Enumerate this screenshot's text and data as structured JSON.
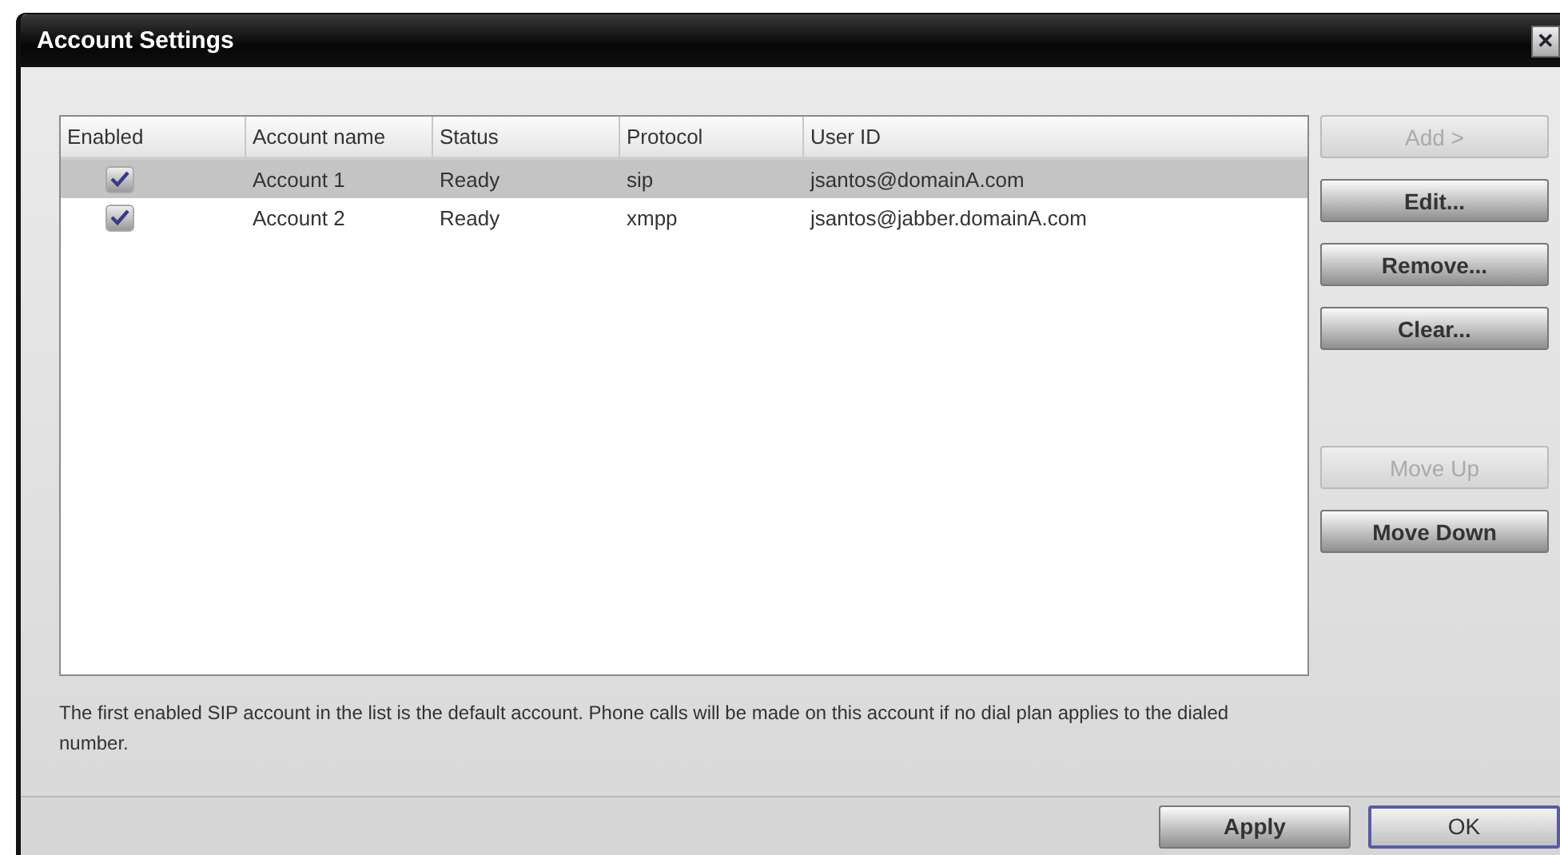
{
  "window": {
    "title": "Account Settings",
    "close": "✕"
  },
  "table": {
    "columns": [
      "Enabled",
      "Account name",
      "Status",
      "Protocol",
      "User ID"
    ],
    "rows": [
      {
        "enabled": true,
        "selected": true,
        "account_name": "Account 1",
        "status": "Ready",
        "protocol": "sip",
        "user_id": "jsantos@domainA.com"
      },
      {
        "enabled": true,
        "selected": false,
        "account_name": "Account 2",
        "status": "Ready",
        "protocol": "xmpp",
        "user_id": "jsantos@jabber.domainA.com"
      }
    ]
  },
  "side_buttons": [
    {
      "label": "Add >",
      "disabled": true
    },
    {
      "label": "Edit...",
      "disabled": false
    },
    {
      "label": "Remove...",
      "disabled": false
    },
    {
      "label": "Clear...",
      "disabled": false
    }
  ],
  "order_buttons": [
    {
      "label": "Move Up",
      "disabled": true
    },
    {
      "label": "Move Down",
      "disabled": false
    }
  ],
  "note": "The first enabled SIP account in the list is the default account. Phone calls will be made on this account if no dial plan applies to the dialed number.",
  "footer_buttons": [
    {
      "label": "Apply",
      "focused": false
    },
    {
      "label": "OK",
      "focused": true
    }
  ]
}
